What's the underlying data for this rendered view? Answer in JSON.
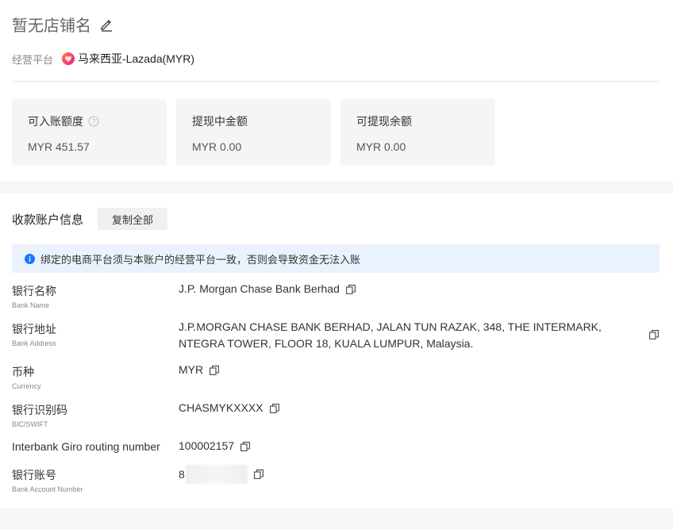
{
  "store": {
    "name": "暂无店铺名"
  },
  "platform": {
    "label": "经营平台",
    "value": "马来西亚-Lazada(MYR)"
  },
  "stats": [
    {
      "label": "可入账额度",
      "value": "MYR 451.57",
      "has_help": true
    },
    {
      "label": "提现中金额",
      "value": "MYR 0.00"
    },
    {
      "label": "可提现余额",
      "value": "MYR 0.00"
    }
  ],
  "account": {
    "title": "收款账户信息",
    "copy_all": "复制全部",
    "notice": "绑定的电商平台须与本账户的经营平台一致，否则会导致资金无法入账",
    "rows": {
      "bank_name": {
        "label": "银行名称",
        "sub": "Bank Name",
        "value": "J.P. Morgan Chase Bank Berhad"
      },
      "bank_address": {
        "label": "银行地址",
        "sub": "Bank Address",
        "line1": "J.P.MORGAN CHASE BANK BERHAD, JALAN TUN RAZAK, 348, THE INTERMARK,",
        "line2": "NTEGRA TOWER, FLOOR 18, KUALA LUMPUR, Malaysia."
      },
      "currency": {
        "label": "币种",
        "sub": "Currency",
        "value": "MYR"
      },
      "swift": {
        "label": "银行识别码",
        "sub": "BIC/SWIFT",
        "value": "CHASMYKXXXX"
      },
      "giro": {
        "label": "Interbank Giro routing number",
        "value": "100002157"
      },
      "account_no": {
        "label": "银行账号",
        "sub": "Bank Account Number",
        "value": "8"
      }
    }
  },
  "colors": {
    "accent": "#1677ff",
    "notice_bg": "#eaf3fd",
    "stat_bg": "#f4f5f7"
  }
}
